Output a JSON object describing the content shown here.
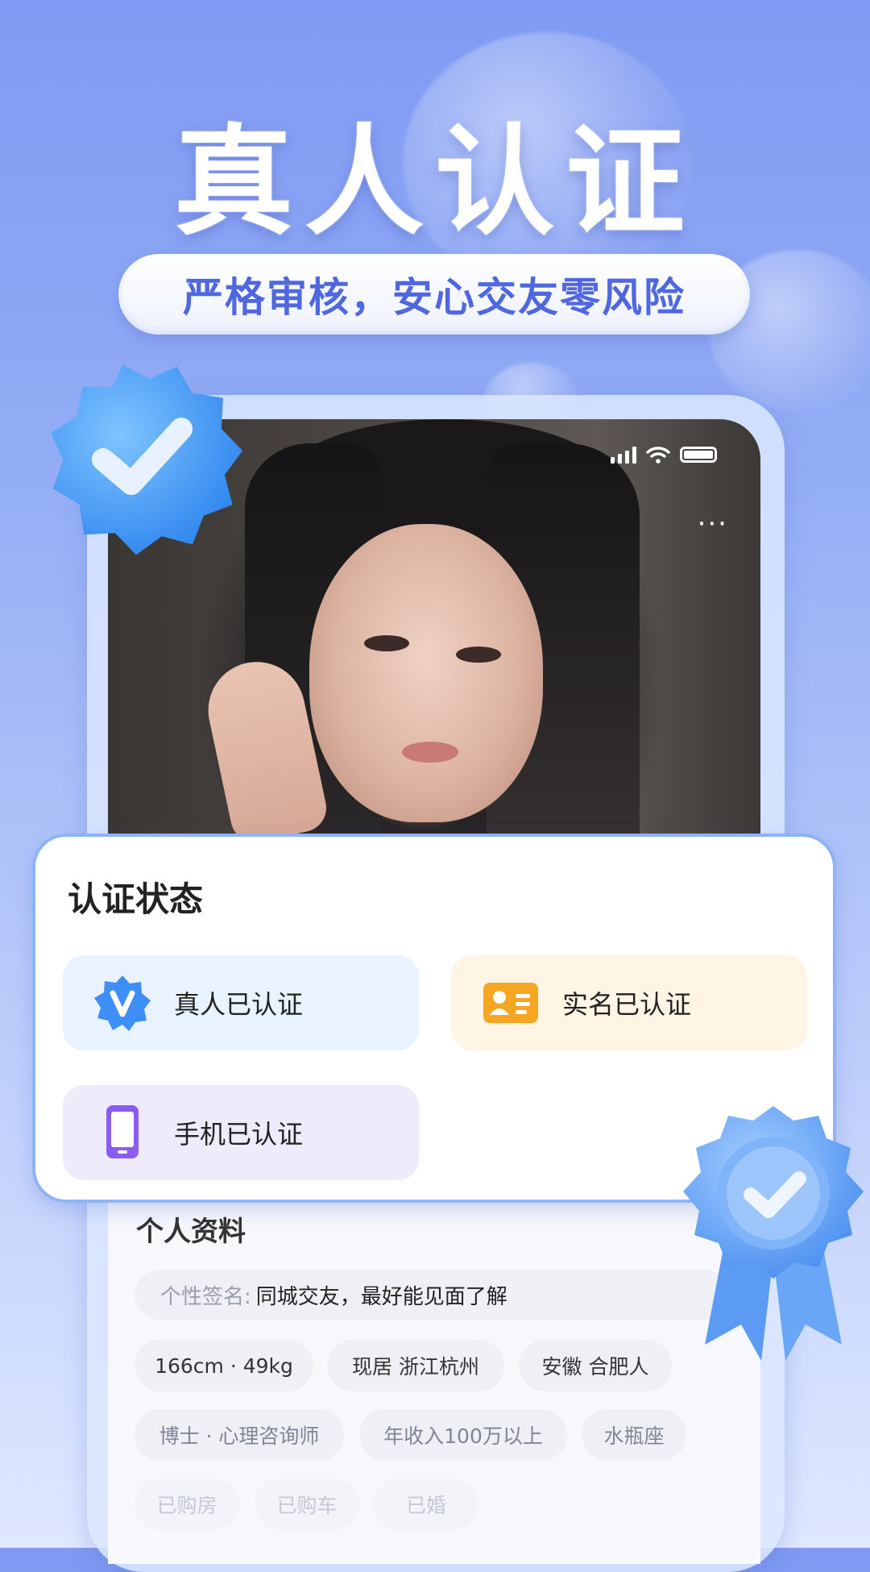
{
  "hero": {
    "title": "真人认证",
    "subtitle": "严格审核，安心交友零风险"
  },
  "status_card": {
    "title": "认证状态",
    "items": [
      {
        "label": "真人已认证",
        "icon": "verified-v-badge-icon",
        "color": "#3d8ef5"
      },
      {
        "label": "实名已认证",
        "icon": "id-card-icon",
        "color": "#f6a623"
      },
      {
        "label": "手机已认证",
        "icon": "phone-icon",
        "color": "#8a5cf0"
      }
    ]
  },
  "profile": {
    "title": "个人资料",
    "signature_key": "个性签名:",
    "signature_value": "同城交友，最好能见面了解",
    "tags_row1": [
      "166cm · 49kg",
      "现居 浙江杭州",
      "安徽 合肥人"
    ],
    "tags_row2": [
      "博士 · 心理咨询师",
      "年收入100万以上",
      "水瓶座"
    ],
    "tags_row3": [
      "已购房",
      "已购车",
      "已婚"
    ]
  },
  "menu": {
    "more": "···"
  },
  "colors": {
    "accent": "#4f67e0",
    "badge_blue": "#4a9cf8"
  }
}
